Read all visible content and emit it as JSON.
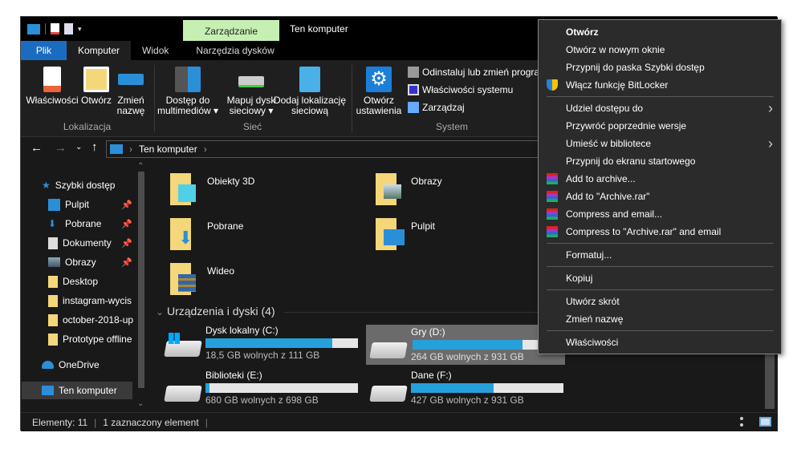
{
  "window": {
    "title": "Ten komputer",
    "context_tab": "Zarządzanie"
  },
  "ribbon_tabs": [
    {
      "label": "Plik"
    },
    {
      "label": "Komputer"
    },
    {
      "label": "Widok"
    },
    {
      "label": "Narzędzia dysków"
    }
  ],
  "ribbon": {
    "groups": [
      {
        "label": "Lokalizacja",
        "buttons": [
          "Właściwości",
          "Otwórz",
          "Zmień nazwę"
        ]
      },
      {
        "label": "Sieć",
        "buttons": [
          "Dostęp do multimediów",
          "Mapuj dysk sieciowy",
          "Dodaj lokalizację sieciową"
        ]
      },
      {
        "label": "System",
        "buttons": [
          "Otwórz ustawienia"
        ],
        "small": [
          "Odinstaluj lub zmień progra",
          "Właściwości systemu",
          "Zarządzaj"
        ]
      }
    ]
  },
  "address": {
    "path": "Ten komputer"
  },
  "nav": {
    "items": [
      {
        "label": "Szybki dostęp",
        "icon": "star-icon"
      },
      {
        "label": "Pulpit",
        "pinned": true
      },
      {
        "label": "Pobrane",
        "pinned": true
      },
      {
        "label": "Dokumenty",
        "pinned": true
      },
      {
        "label": "Obrazy",
        "pinned": true
      },
      {
        "label": "Desktop"
      },
      {
        "label": "instagram-wycis"
      },
      {
        "label": "october-2018-up"
      },
      {
        "label": "Prototype offline"
      },
      {
        "label": "OneDrive"
      },
      {
        "label": "Ten komputer",
        "selected": true
      }
    ]
  },
  "folders": [
    {
      "label": "Obiekty 3D"
    },
    {
      "label": "Obrazy"
    },
    {
      "label": "Pobrane"
    },
    {
      "label": "Pulpit"
    },
    {
      "label": "Wideo"
    }
  ],
  "devices": {
    "header": "Urządzenia i dyski (4)",
    "drives": [
      {
        "name": "Dysk lokalny (C:)",
        "free": "18,5 GB wolnych z 111 GB",
        "used_fraction": 0.83
      },
      {
        "name": "Gry (D:)",
        "free": "264 GB wolnych z 931 GB",
        "used_fraction": 0.72,
        "selected": true
      },
      {
        "name": "Biblioteki (E:)",
        "free": "680 GB wolnych z 698 GB",
        "used_fraction": 0.026
      },
      {
        "name": "Dane (F:)",
        "free": "427 GB wolnych z 931 GB",
        "used_fraction": 0.54
      }
    ]
  },
  "status": {
    "items": "Elementy: 11",
    "selected": "1 zaznaczony element"
  },
  "context_menu": {
    "items": [
      "Otwórz",
      "Otwórz w nowym oknie",
      "Przypnij do paska Szybki dostęp",
      "Włącz funkcję BitLocker",
      "Udziel dostępu do",
      "Przywróć poprzednie wersje",
      "Umieść w bibliotece",
      "Przypnij do ekranu startowego",
      "Add to archive...",
      "Add to \"Archive.rar\"",
      "Compress and email...",
      "Compress to \"Archive.rar\" and email",
      "Formatuj...",
      "Kopiuj",
      "Utwórz skrót",
      "Zmień nazwę",
      "Właściwości"
    ]
  },
  "colors": {
    "accent": "#1b6cc1",
    "context_tab": "#c6efb3",
    "progress": "#26a0da",
    "background": "#191919"
  }
}
